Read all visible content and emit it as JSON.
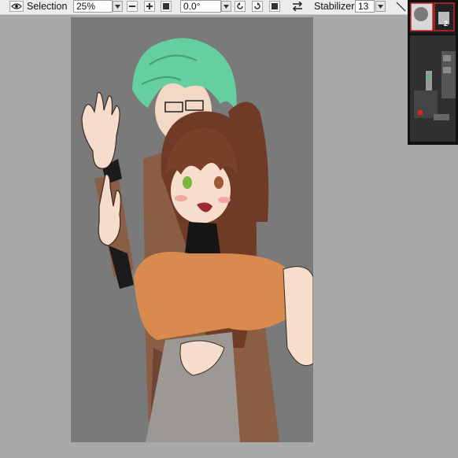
{
  "toolbar": {
    "selection_label": "Selection",
    "zoom_value": "25%",
    "rotation_value": "0.0°",
    "stabilizer_label": "Stabilizer",
    "stabilizer_value": "13"
  },
  "navigator": {
    "badge_number": "2"
  },
  "icons": {
    "eye": "eye-icon",
    "zoom_out": "minus-icon",
    "zoom_in": "plus-icon",
    "fit": "square-icon",
    "rotate_ccw": "rotate-left-icon",
    "rotate_cw": "rotate-right-icon",
    "reset_rotation": "square-icon",
    "flip": "flip-arrows-icon",
    "stabilizer_dropdown": "chevron-down-icon"
  },
  "colors": {
    "workspace": "#a9a9a9",
    "toolbar": "#ececec",
    "canvas_bg": "#7a7a7a",
    "navigator": "#111111"
  }
}
